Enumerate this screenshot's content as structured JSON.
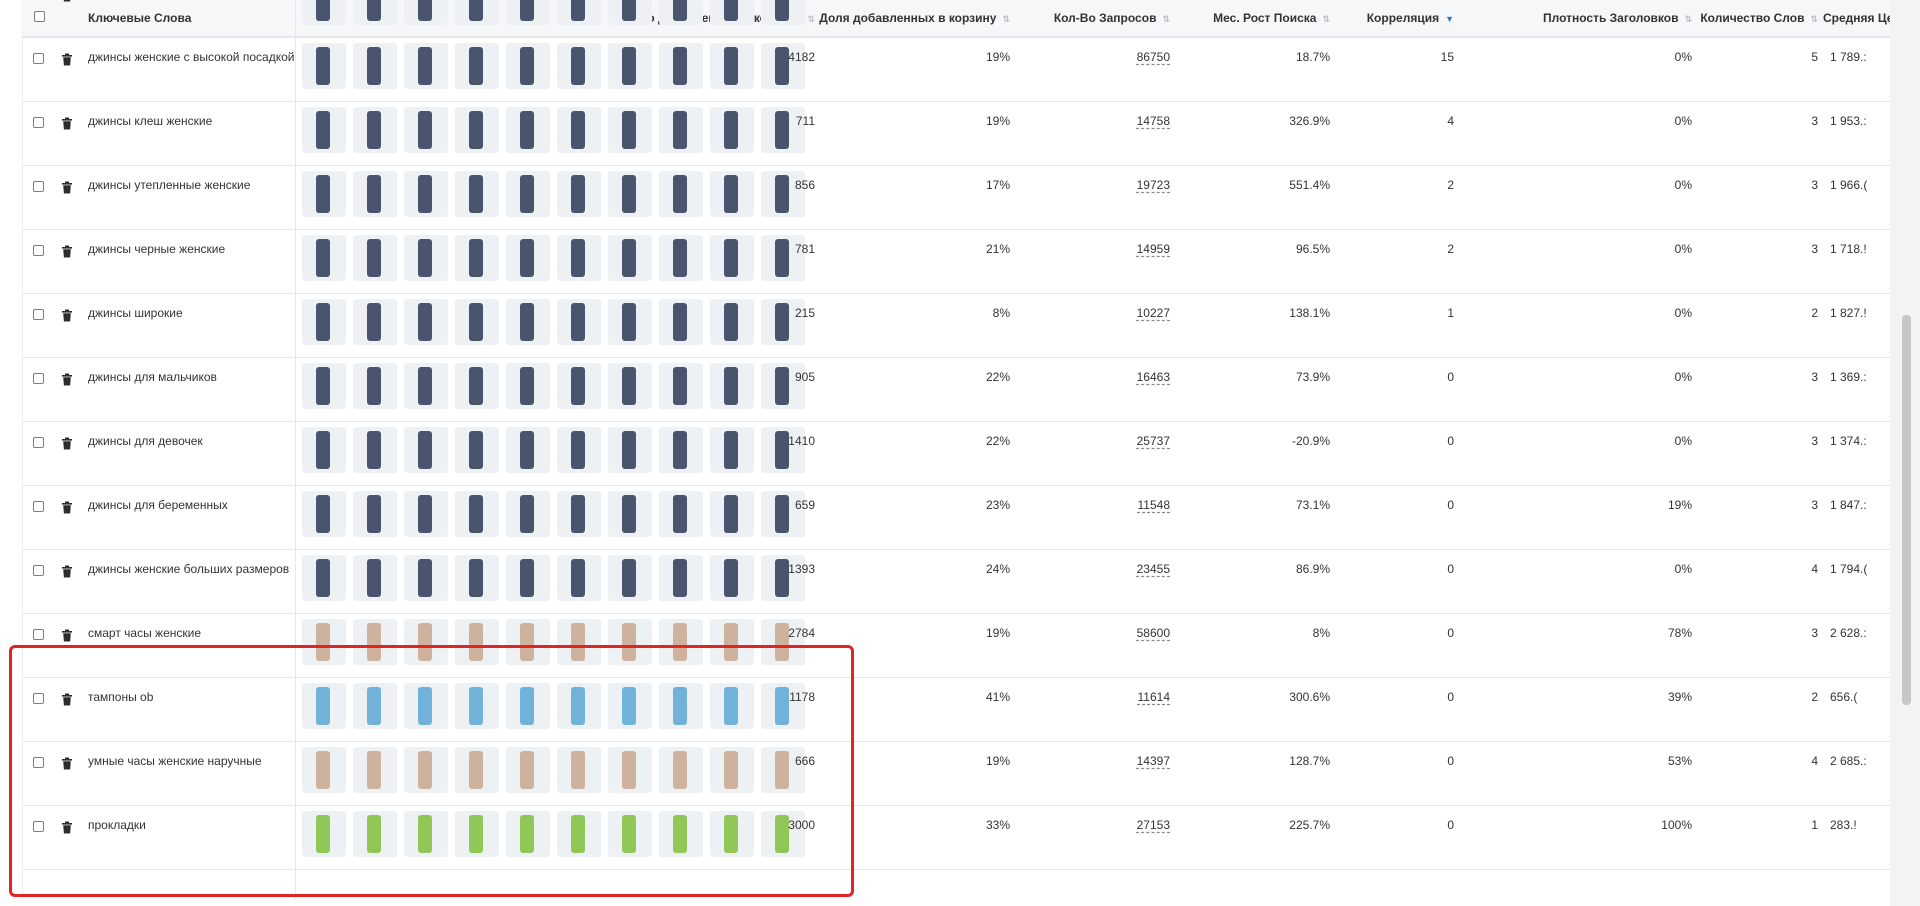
{
  "header": {
    "keywords_label": "Ключевые Слова",
    "columns": [
      {
        "label": "Кол-во добавленных в корзину"
      },
      {
        "label": "Доля добавленных в корзину"
      },
      {
        "label": "Кол-Во Запросов"
      },
      {
        "label": "Мес. Рост Поиска"
      },
      {
        "label": "Корреляция"
      },
      {
        "label": "Плотность Заголовков"
      },
      {
        "label": "Количество Слов"
      },
      {
        "label": "Средняя Цен"
      }
    ]
  },
  "rows": [
    {
      "keyword": "",
      "cart": "",
      "share": "",
      "requests": "",
      "growth": "",
      "corr": "",
      "density": "",
      "words": "",
      "price": ""
    },
    {
      "keyword": "джинсы женские с высокой посадкой",
      "cart": "4182",
      "share": "19%",
      "requests": "86750",
      "growth": "18.7%",
      "corr": "15",
      "density": "0%",
      "words": "5",
      "price": "1 789.:"
    },
    {
      "keyword": "джинсы клеш женские",
      "cart": "711",
      "share": "19%",
      "requests": "14758",
      "growth": "326.9%",
      "corr": "4",
      "density": "0%",
      "words": "3",
      "price": "1 953.:"
    },
    {
      "keyword": "джинсы утепленные женские",
      "cart": "856",
      "share": "17%",
      "requests": "19723",
      "growth": "551.4%",
      "corr": "2",
      "density": "0%",
      "words": "3",
      "price": "1 966.("
    },
    {
      "keyword": "джинсы черные женские",
      "cart": "781",
      "share": "21%",
      "requests": "14959",
      "growth": "96.5%",
      "corr": "2",
      "density": "0%",
      "words": "3",
      "price": "1 718.!"
    },
    {
      "keyword": "джинсы широкие",
      "cart": "215",
      "share": "8%",
      "requests": "10227",
      "growth": "138.1%",
      "corr": "1",
      "density": "0%",
      "words": "2",
      "price": "1 827.!"
    },
    {
      "keyword": "джинсы для мальчиков",
      "cart": "905",
      "share": "22%",
      "requests": "16463",
      "growth": "73.9%",
      "corr": "0",
      "density": "0%",
      "words": "3",
      "price": "1 369.:"
    },
    {
      "keyword": "джинсы для девочек",
      "cart": "1410",
      "share": "22%",
      "requests": "25737",
      "growth": "-20.9%",
      "corr": "0",
      "density": "0%",
      "words": "3",
      "price": "1 374.:"
    },
    {
      "keyword": "джинсы для беременных",
      "cart": "659",
      "share": "23%",
      "requests": "11548",
      "growth": "73.1%",
      "corr": "0",
      "density": "19%",
      "words": "3",
      "price": "1 847.:"
    },
    {
      "keyword": "джинсы женские больших размеров",
      "cart": "1393",
      "share": "24%",
      "requests": "23455",
      "growth": "86.9%",
      "corr": "0",
      "density": "0%",
      "words": "4",
      "price": "1 794.("
    },
    {
      "keyword": "смарт часы женские",
      "cart": "2784",
      "share": "19%",
      "requests": "58600",
      "growth": "8%",
      "corr": "0",
      "density": "78%",
      "words": "3",
      "price": "2 628.:"
    },
    {
      "keyword": "тампоны ob",
      "cart": "1178",
      "share": "41%",
      "requests": "11614",
      "growth": "300.6%",
      "corr": "0",
      "density": "39%",
      "words": "2",
      "price": "656.("
    },
    {
      "keyword": "умные часы женские наручные",
      "cart": "666",
      "share": "19%",
      "requests": "14397",
      "growth": "128.7%",
      "corr": "0",
      "density": "53%",
      "words": "4",
      "price": "2 685.:"
    },
    {
      "keyword": "прокладки",
      "cart": "3000",
      "share": "33%",
      "requests": "27153",
      "growth": "225.7%",
      "corr": "0",
      "density": "100%",
      "words": "1",
      "price": "283.!"
    }
  ],
  "colors": {
    "highlight": "#e02424",
    "sort_active": "#3b6fd6",
    "jeans": "#2b3a55",
    "watch": "#c9a78e",
    "tampon": "#5aa7d6",
    "pad": "#7fbf3a"
  }
}
